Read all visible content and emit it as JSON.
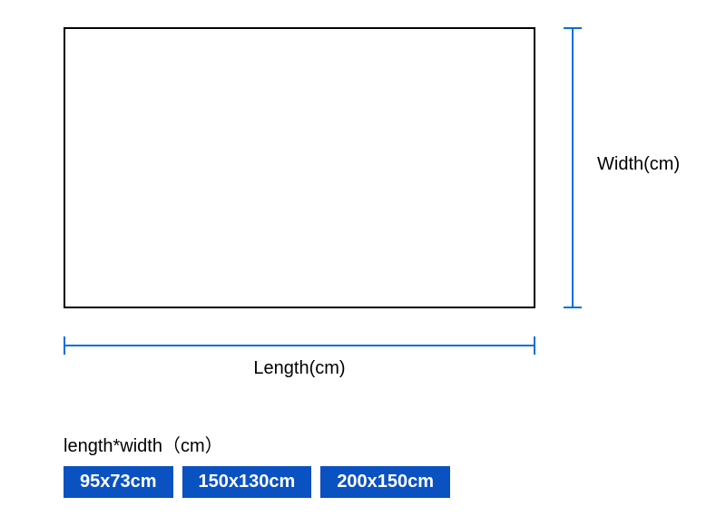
{
  "labels": {
    "width": "Width(cm)",
    "length": "Length(cm)",
    "heading": "length*width（cm）"
  },
  "sizes": [
    "95x73cm",
    "150x130cm",
    "200x150cm"
  ],
  "colors": {
    "dimension_line": "#0a6fd6",
    "chip_bg": "#0a51c2"
  }
}
